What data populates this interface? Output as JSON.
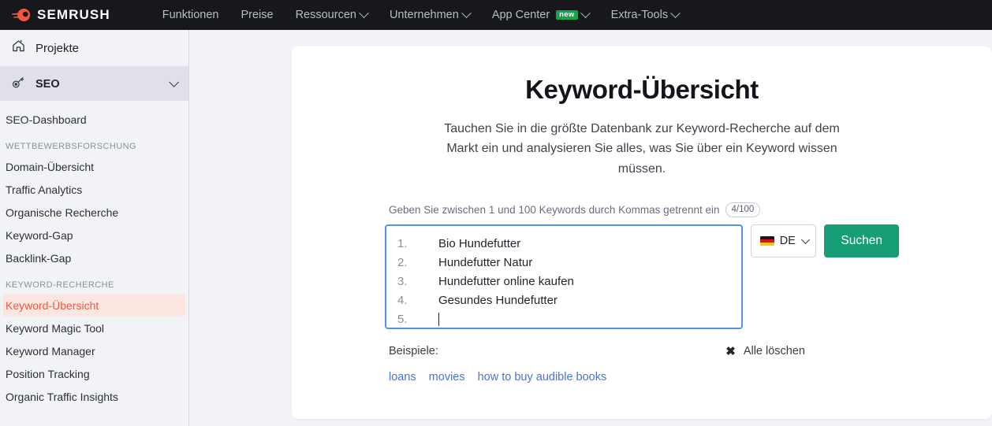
{
  "brand": {
    "name": "SEMRUSH",
    "logo_icon": "semrush-comet-logo",
    "accent": "#f4573b"
  },
  "topnav": {
    "items": [
      {
        "label": "Funktionen",
        "has_chevron": false,
        "badge": null
      },
      {
        "label": "Preise",
        "has_chevron": false,
        "badge": null
      },
      {
        "label": "Ressourcen",
        "has_chevron": true,
        "badge": null
      },
      {
        "label": "Unternehmen",
        "has_chevron": true,
        "badge": null
      },
      {
        "label": "App Center",
        "has_chevron": true,
        "badge": "new"
      },
      {
        "label": "Extra-Tools",
        "has_chevron": true,
        "badge": null
      }
    ]
  },
  "sidebar": {
    "projects": {
      "label": "Projekte",
      "icon": "home-icon"
    },
    "seo": {
      "label": "SEO",
      "icon": "key-icon",
      "chevron": "chevron-down-icon"
    },
    "dashboard": {
      "label": "SEO-Dashboard"
    },
    "groups": [
      {
        "heading": "WETTBEWERBSFORSCHUNG",
        "items": [
          {
            "label": "Domain-Übersicht",
            "active": false
          },
          {
            "label": "Traffic Analytics",
            "active": false
          },
          {
            "label": "Organische Recherche",
            "active": false
          },
          {
            "label": "Keyword-Gap",
            "active": false
          },
          {
            "label": "Backlink-Gap",
            "active": false
          }
        ]
      },
      {
        "heading": "KEYWORD-RECHERCHE",
        "items": [
          {
            "label": "Keyword-Übersicht",
            "active": true
          },
          {
            "label": "Keyword Magic Tool",
            "active": false
          },
          {
            "label": "Keyword Manager",
            "active": false
          },
          {
            "label": "Position Tracking",
            "active": false
          },
          {
            "label": "Organic Traffic Insights",
            "active": false
          }
        ]
      }
    ]
  },
  "main": {
    "title": "Keyword-Übersicht",
    "subtitle": "Tauchen Sie in die größte Datenbank zur Keyword-Recherche auf dem Markt ein und analysieren Sie alles, was Sie über ein Keyword wissen müssen.",
    "field_label": "Geben Sie zwischen 1 und 100 Keywords durch Kommas getrennt ein",
    "counter": "4/100",
    "keywords": [
      {
        "num": "1.",
        "text": "Bio Hundefutter"
      },
      {
        "num": "2.",
        "text": "Hundefutter Natur"
      },
      {
        "num": "3.",
        "text": "Hundefutter online kaufen"
      },
      {
        "num": "4.",
        "text": "Gesundes Hundefutter"
      },
      {
        "num": "5.",
        "text": ""
      }
    ],
    "country": {
      "code": "DE",
      "flag": "german-flag-icon",
      "chevron": "chevron-down-icon"
    },
    "search_button": "Suchen",
    "examples_label": "Beispiele:",
    "clear_all": {
      "label": "Alle löschen",
      "icon": "close-x-icon"
    },
    "example_links": [
      "loans",
      "movies",
      "how to buy audible books"
    ]
  },
  "colors": {
    "nav_bg": "#16181c",
    "page_bg": "#f2f3f7",
    "active_sidebar_bg": "#fbe6e2",
    "active_sidebar_text": "#f4573b",
    "search_button": "#189e76",
    "focus_border": "#5893e8",
    "link_blue": "#4d72d6",
    "badge_green": "#16a34a"
  }
}
